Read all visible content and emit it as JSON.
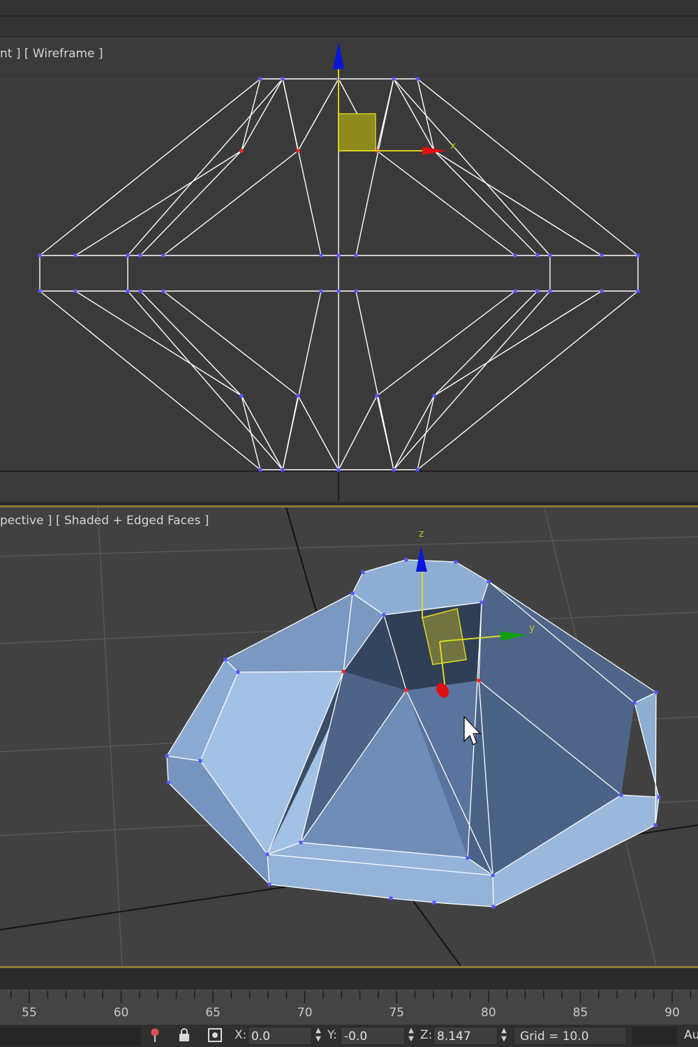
{
  "front_viewport": {
    "label": "nt ] [ Wireframe ]",
    "gizmo_axis_x": "x"
  },
  "perspective_viewport": {
    "label": "pective ] [ Shaded + Edged Faces ]",
    "gizmo_axis_z": "z",
    "gizmo_axis_y": "y"
  },
  "timeline": {
    "ticks": [
      "55",
      "60",
      "65",
      "70",
      "75",
      "80",
      "85",
      "90"
    ]
  },
  "status": {
    "icons": [
      "key-pin-icon",
      "lock-icon",
      "absolute-mode-icon"
    ],
    "x_label": "X:",
    "x_value": "0.0",
    "y_label": "Y:",
    "y_value": "-0.0",
    "z_label": "Z:",
    "z_value": "8.147",
    "grid": "Grid = 10.0",
    "auto_label": "Au"
  },
  "colors": {
    "wire": "#ffffff",
    "vertex": "#5a55ff",
    "selected_vertex": "#ff2020",
    "axis_x": "#e01010",
    "axis_y": "#10a010",
    "axis_z": "#0a16d8",
    "plane_handle": "#c8c020",
    "shaded_face": "#7f9fc8",
    "viewport_border": "#8a7a3c"
  }
}
